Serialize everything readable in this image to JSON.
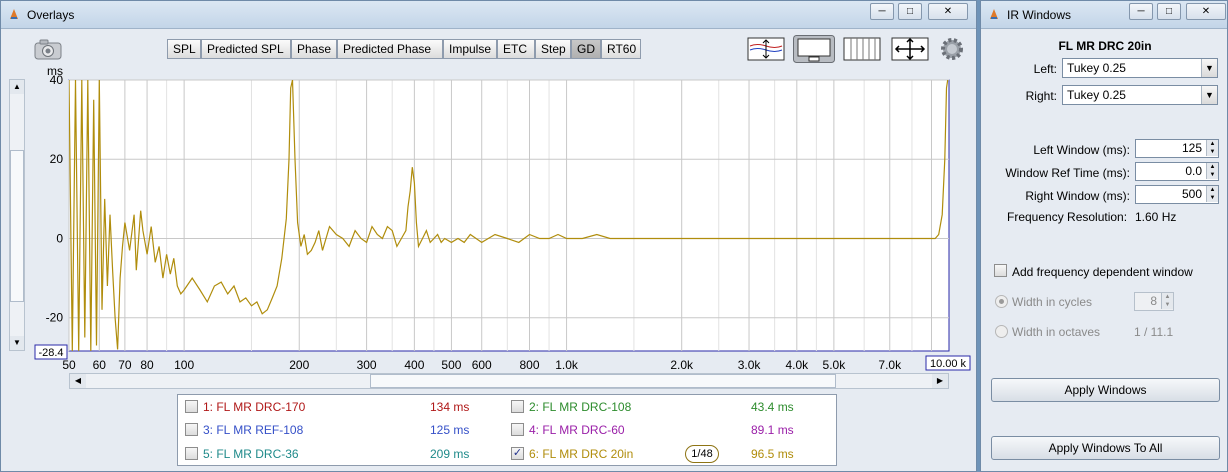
{
  "overlays_window": {
    "title": "Overlays",
    "buttons": {
      "minimize": "─",
      "maximize": "□",
      "close": "✕"
    },
    "tabs": [
      {
        "label": "SPL",
        "active": false
      },
      {
        "label": "Predicted SPL",
        "active": false
      },
      {
        "label": "Phase",
        "active": false
      },
      {
        "label": "Predicted Phase",
        "active": false
      },
      {
        "label": "Impulse",
        "active": false
      },
      {
        "label": "ETC",
        "active": false
      },
      {
        "label": "Step",
        "active": false
      },
      {
        "label": "GD",
        "active": true
      },
      {
        "label": "RT60",
        "active": false
      }
    ],
    "icons": [
      "camera-icon",
      "waveform-icon",
      "display-panel-icon",
      "grid-icon",
      "move-arrows-icon",
      "gear-icon"
    ],
    "y_unit": "ms",
    "y_min_readout": "-28.4",
    "x_max_readout": "10.00 k",
    "legend": [
      {
        "label": "1: FL MR DRC-170",
        "value": "134 ms",
        "color": "#b01818",
        "checked": false
      },
      {
        "label": "2: FL MR DRC-108",
        "value": "43.4 ms",
        "color": "#2d8c2d",
        "checked": false
      },
      {
        "label": "3: FL MR REF-108",
        "value": "125 ms",
        "color": "#3550c8",
        "checked": false
      },
      {
        "label": "4: FL MR DRC-60",
        "value": "89.1 ms",
        "color": "#9a1fa8",
        "checked": false
      },
      {
        "label": "5: FL MR DRC-36",
        "value": "209 ms",
        "color": "#1f8a8a",
        "checked": false
      },
      {
        "label": "6: FL MR DRC 20in",
        "value": "96.5 ms",
        "color": "#b08d0c",
        "checked": true
      }
    ],
    "smoothing": "1/48",
    "checkmark": "✓"
  },
  "ir_window": {
    "title": "IR Windows",
    "buttons": {
      "minimize": "─",
      "maximize": "□",
      "close": "✕"
    },
    "measurement": "FL MR DRC 20in",
    "left_label": "Left:",
    "left_value": "Tukey 0.25",
    "right_label": "Right:",
    "right_value": "Tukey 0.25",
    "left_window_label": "Left Window (ms):",
    "left_window_value": "125",
    "ref_time_label": "Window Ref Time (ms):",
    "ref_time_value": "0.0",
    "right_window_label": "Right Window (ms):",
    "right_window_value": "500",
    "freq_res_label": "Frequency Resolution:",
    "freq_res_value": "1.60 Hz",
    "fdw_label": "Add frequency dependent window",
    "cycles_label": "Width in cycles",
    "cycles_value": "8",
    "octaves_label": "Width in octaves",
    "octaves_value": "1 / 11.1",
    "apply_label": "Apply Windows",
    "apply_all_label": "Apply Windows To All"
  },
  "chart_data": {
    "type": "line",
    "title": "",
    "xlabel": "",
    "ylabel": "ms",
    "x_scale": "log",
    "xlim": [
      50,
      10000
    ],
    "ylim": [
      -28.4,
      40
    ],
    "x_ticks": [
      {
        "v": 50,
        "label": "50"
      },
      {
        "v": 60,
        "label": "60"
      },
      {
        "v": 70,
        "label": "70"
      },
      {
        "v": 80,
        "label": "80"
      },
      {
        "v": 100,
        "label": "100"
      },
      {
        "v": 200,
        "label": "200"
      },
      {
        "v": 300,
        "label": "300"
      },
      {
        "v": 400,
        "label": "400"
      },
      {
        "v": 500,
        "label": "500"
      },
      {
        "v": 600,
        "label": "600"
      },
      {
        "v": 800,
        "label": "800"
      },
      {
        "v": 1000,
        "label": "1.0k"
      },
      {
        "v": 2000,
        "label": "2.0k"
      },
      {
        "v": 3000,
        "label": "3.0k"
      },
      {
        "v": 4000,
        "label": "4.0k"
      },
      {
        "v": 5000,
        "label": "5.0k"
      },
      {
        "v": 7000,
        "label": "7.0k"
      },
      {
        "v": 9000,
        "label": "10"
      }
    ],
    "minor_x": [
      90,
      150,
      250,
      350,
      450,
      700,
      900,
      1500,
      2500,
      3500,
      4500,
      6000,
      8000
    ],
    "y_ticks": [
      {
        "v": 40,
        "label": "40"
      },
      {
        "v": 20,
        "label": "20"
      },
      {
        "v": 0,
        "label": "0"
      },
      {
        "v": -20,
        "label": "-20"
      }
    ],
    "series": [
      {
        "color": "#b08d0c",
        "points": [
          [
            50,
            40
          ],
          [
            51,
            -28.4
          ],
          [
            52,
            40
          ],
          [
            53,
            -28.4
          ],
          [
            54,
            40
          ],
          [
            55,
            -25
          ],
          [
            56,
            40
          ],
          [
            57,
            -28.4
          ],
          [
            58,
            35
          ],
          [
            59,
            -27
          ],
          [
            60,
            40
          ],
          [
            61,
            -18
          ],
          [
            62,
            10
          ],
          [
            63,
            -12
          ],
          [
            64,
            6
          ],
          [
            65,
            -8
          ],
          [
            66,
            -20
          ],
          [
            67,
            -28
          ],
          [
            68,
            -10
          ],
          [
            69,
            -2
          ],
          [
            70,
            4
          ],
          [
            72,
            -3
          ],
          [
            74,
            6
          ],
          [
            75,
            -8
          ],
          [
            77,
            7
          ],
          [
            78,
            2
          ],
          [
            80,
            -4
          ],
          [
            82,
            3
          ],
          [
            84,
            -6
          ],
          [
            86,
            -2
          ],
          [
            88,
            -10
          ],
          [
            90,
            -4
          ],
          [
            92,
            -9
          ],
          [
            94,
            -5
          ],
          [
            96,
            -12
          ],
          [
            98,
            -14
          ],
          [
            100,
            -13
          ],
          [
            105,
            -10
          ],
          [
            110,
            -13
          ],
          [
            115,
            -16
          ],
          [
            120,
            -12
          ],
          [
            125,
            -11
          ],
          [
            130,
            -14
          ],
          [
            135,
            -12
          ],
          [
            140,
            -16
          ],
          [
            145,
            -15
          ],
          [
            150,
            -17
          ],
          [
            155,
            -16
          ],
          [
            160,
            -19
          ],
          [
            165,
            -18
          ],
          [
            170,
            -15
          ],
          [
            175,
            -12
          ],
          [
            180,
            -5
          ],
          [
            185,
            5
          ],
          [
            188,
            20
          ],
          [
            190,
            38
          ],
          [
            192,
            40
          ],
          [
            195,
            20
          ],
          [
            198,
            4
          ],
          [
            202,
            -2
          ],
          [
            206,
            1
          ],
          [
            210,
            -4
          ],
          [
            215,
            -3
          ],
          [
            220,
            -1
          ],
          [
            225,
            2
          ],
          [
            230,
            -3
          ],
          [
            240,
            3
          ],
          [
            250,
            1
          ],
          [
            260,
            0
          ],
          [
            270,
            -2
          ],
          [
            280,
            2
          ],
          [
            290,
            0
          ],
          [
            300,
            -1
          ],
          [
            310,
            3
          ],
          [
            320,
            1
          ],
          [
            330,
            0
          ],
          [
            340,
            3
          ],
          [
            350,
            2
          ],
          [
            360,
            -2
          ],
          [
            370,
            0
          ],
          [
            380,
            2
          ],
          [
            385,
            8
          ],
          [
            390,
            12
          ],
          [
            395,
            18
          ],
          [
            400,
            14
          ],
          [
            405,
            4
          ],
          [
            410,
            -2
          ],
          [
            420,
            0
          ],
          [
            430,
            2
          ],
          [
            440,
            -1
          ],
          [
            450,
            0
          ],
          [
            460,
            1
          ],
          [
            470,
            -1
          ],
          [
            480,
            0
          ],
          [
            500,
            -1
          ],
          [
            520,
            0
          ],
          [
            540,
            -1
          ],
          [
            560,
            1
          ],
          [
            580,
            0
          ],
          [
            600,
            -1
          ],
          [
            650,
            1
          ],
          [
            700,
            0
          ],
          [
            750,
            -1
          ],
          [
            800,
            1
          ],
          [
            850,
            0
          ],
          [
            900,
            0
          ],
          [
            950,
            1
          ],
          [
            1000,
            0
          ],
          [
            1100,
            0
          ],
          [
            1200,
            1
          ],
          [
            1300,
            0
          ],
          [
            1500,
            0
          ],
          [
            2000,
            0
          ],
          [
            2500,
            0
          ],
          [
            3000,
            0
          ],
          [
            4000,
            0
          ],
          [
            5000,
            0
          ],
          [
            6000,
            0
          ],
          [
            7000,
            0
          ],
          [
            8000,
            0
          ],
          [
            9200,
            0
          ],
          [
            9400,
            1
          ],
          [
            9600,
            6
          ],
          [
            9750,
            20
          ],
          [
            9850,
            38
          ],
          [
            9920,
            40
          ]
        ]
      }
    ]
  }
}
